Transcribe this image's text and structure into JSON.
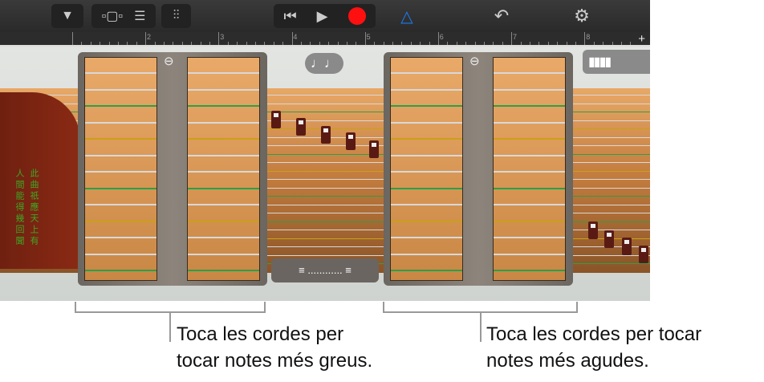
{
  "toolbar": {
    "buttons": [
      "browser-icon",
      "view-toggle-icon",
      "tracks-icon",
      "mixer-icon",
      "go-to-start-icon",
      "play-icon",
      "record-icon",
      "metronome-icon",
      "undo-icon",
      "settings-icon"
    ],
    "record_color": "#ff1010",
    "metronome_color": "#1a7cf5"
  },
  "ruler": {
    "bars": [
      "2",
      "3",
      "4",
      "5",
      "6",
      "7",
      "8"
    ],
    "add": "+"
  },
  "instrument": {
    "inscription_right": "此曲祇應天上有",
    "inscription_left": "人間能得幾回聞",
    "notes_button": "♩♩",
    "chord_strip": "≡ ............ ≡"
  },
  "string_colors": [
    "#d8d8d8",
    "#d8d8d8",
    "#2aa04a",
    "#d8d8d8",
    "#c9a018",
    "#d8d8d8",
    "#d8d8d8",
    "#2aa04a",
    "#d8d8d8",
    "#c9a018",
    "#d8d8d8",
    "#d8d8d8",
    "#2aa04a"
  ],
  "callouts": {
    "left": [
      "Toca les cordes per",
      "tocar notes més greus."
    ],
    "right": [
      "Toca les cordes per tocar",
      "notes més agudes."
    ]
  }
}
